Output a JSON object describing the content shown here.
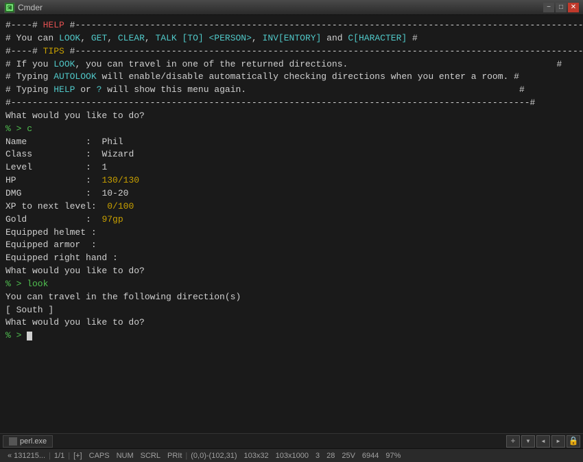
{
  "titlebar": {
    "title": "Cmder",
    "minimize": "−",
    "maximize": "□",
    "close": "✕"
  },
  "terminal": {
    "lines": [
      {
        "id": "l1",
        "text": "#----# ",
        "color": "default",
        "parts": [
          {
            "t": "#----# ",
            "c": "default"
          },
          {
            "t": "HELP",
            "c": "red"
          },
          {
            "t": " #-----------------------------------------------------------------------------------------------#",
            "c": "default"
          }
        ]
      },
      {
        "id": "l2",
        "parts": [
          {
            "t": "# You can ",
            "c": "default"
          },
          {
            "t": "LOOK",
            "c": "cyan"
          },
          {
            "t": ", ",
            "c": "default"
          },
          {
            "t": "GET",
            "c": "cyan"
          },
          {
            "t": ", ",
            "c": "default"
          },
          {
            "t": "CLEAR",
            "c": "cyan"
          },
          {
            "t": ", ",
            "c": "default"
          },
          {
            "t": "TALK [TO] <PERSON>",
            "c": "cyan"
          },
          {
            "t": ", ",
            "c": "default"
          },
          {
            "t": "INV[ENTORY]",
            "c": "cyan"
          },
          {
            "t": " and ",
            "c": "default"
          },
          {
            "t": "C[HARACTER]",
            "c": "cyan"
          },
          {
            "t": " #",
            "c": "default"
          }
        ]
      },
      {
        "id": "l3",
        "parts": [
          {
            "t": "#----# ",
            "c": "default"
          },
          {
            "t": "TIPS",
            "c": "yellow"
          },
          {
            "t": " #-----------------------------------------------------------------------------------------------#",
            "c": "default"
          }
        ]
      },
      {
        "id": "l4",
        "parts": [
          {
            "t": "# If you ",
            "c": "default"
          },
          {
            "t": "LOOK",
            "c": "cyan"
          },
          {
            "t": ", you can travel in one of the returned directions.                                       #",
            "c": "default"
          }
        ]
      },
      {
        "id": "l5",
        "parts": [
          {
            "t": "# Typing ",
            "c": "default"
          },
          {
            "t": "AUTOLOOK",
            "c": "cyan"
          },
          {
            "t": " will enable/disable automatically checking directions when you enter a room. #",
            "c": "default"
          }
        ]
      },
      {
        "id": "l6",
        "parts": [
          {
            "t": "# Typing ",
            "c": "default"
          },
          {
            "t": "HELP",
            "c": "cyan"
          },
          {
            "t": " or ",
            "c": "default"
          },
          {
            "t": "?",
            "c": "cyan"
          },
          {
            "t": " will show this menu again.                                                   #",
            "c": "default"
          }
        ]
      },
      {
        "id": "l7",
        "parts": [
          {
            "t": "#-------------------------------------------------------------------------------------------------#",
            "c": "default"
          }
        ]
      },
      {
        "id": "l8",
        "parts": [
          {
            "t": "",
            "c": "default"
          }
        ]
      },
      {
        "id": "l9",
        "parts": [
          {
            "t": "What would you like to do?",
            "c": "default"
          }
        ]
      },
      {
        "id": "l10",
        "parts": [
          {
            "t": "% > c",
            "c": "prompt"
          }
        ]
      },
      {
        "id": "l11",
        "parts": [
          {
            "t": "Name           :  ",
            "c": "default"
          },
          {
            "t": "Phil",
            "c": "default"
          }
        ]
      },
      {
        "id": "l12",
        "parts": [
          {
            "t": "Class          :  ",
            "c": "default"
          },
          {
            "t": "Wizard",
            "c": "default"
          }
        ]
      },
      {
        "id": "l13",
        "parts": [
          {
            "t": "Level          :  ",
            "c": "default"
          },
          {
            "t": "1",
            "c": "default"
          }
        ]
      },
      {
        "id": "l14",
        "parts": [
          {
            "t": "HP             :  ",
            "c": "default"
          },
          {
            "t": "130/130",
            "c": "hp"
          }
        ]
      },
      {
        "id": "l15",
        "parts": [
          {
            "t": "DMG            :  ",
            "c": "default"
          },
          {
            "t": "10-20",
            "c": "default"
          }
        ]
      },
      {
        "id": "l16",
        "parts": [
          {
            "t": "XP to next level:  ",
            "c": "default"
          },
          {
            "t": "0/100",
            "c": "xp"
          }
        ]
      },
      {
        "id": "l17",
        "parts": [
          {
            "t": "Gold           :  ",
            "c": "default"
          },
          {
            "t": "97gp",
            "c": "gold"
          }
        ]
      },
      {
        "id": "l18",
        "parts": [
          {
            "t": "Equipped helmet :  ",
            "c": "default"
          }
        ]
      },
      {
        "id": "l19",
        "parts": [
          {
            "t": "Equipped armor  :  ",
            "c": "default"
          }
        ]
      },
      {
        "id": "l20",
        "parts": [
          {
            "t": "Equipped right hand :  ",
            "c": "default"
          }
        ]
      },
      {
        "id": "l21",
        "parts": [
          {
            "t": "",
            "c": "default"
          }
        ]
      },
      {
        "id": "l22",
        "parts": [
          {
            "t": "What would you like to do?",
            "c": "default"
          }
        ]
      },
      {
        "id": "l23",
        "parts": [
          {
            "t": "% > look",
            "c": "prompt"
          }
        ]
      },
      {
        "id": "l24",
        "parts": [
          {
            "t": "",
            "c": "default"
          }
        ]
      },
      {
        "id": "l25",
        "parts": [
          {
            "t": "You can travel in the following direction(s)",
            "c": "default"
          }
        ]
      },
      {
        "id": "l26",
        "parts": [
          {
            "t": "[ South ]",
            "c": "default"
          }
        ]
      },
      {
        "id": "l27",
        "parts": [
          {
            "t": "",
            "c": "default"
          }
        ]
      },
      {
        "id": "l28",
        "parts": [
          {
            "t": "What would you like to do?",
            "c": "default"
          }
        ]
      },
      {
        "id": "l29",
        "parts": [
          {
            "t": "% > ",
            "c": "prompt"
          }
        ],
        "cursor": true
      }
    ]
  },
  "tabbar": {
    "tab_label": "perl.exe",
    "btn_plus": "+",
    "btn_down": "▾",
    "btn_scroll": "◂",
    "btn_scroll2": "▸",
    "btn_lock": "🔒"
  },
  "statusbar": {
    "position": "« 131215...",
    "line_col": "1/1",
    "bracket": "[+]",
    "caps": "CAPS",
    "num": "NUM",
    "scrl": "SCRL",
    "pri": "PRIt",
    "coords": "(0,0)-(102,31)",
    "size": "103x32",
    "size2": "103x1000",
    "n1": "3",
    "n2": "28",
    "n3": "25V",
    "n4": "6944",
    "pct": "97%"
  }
}
